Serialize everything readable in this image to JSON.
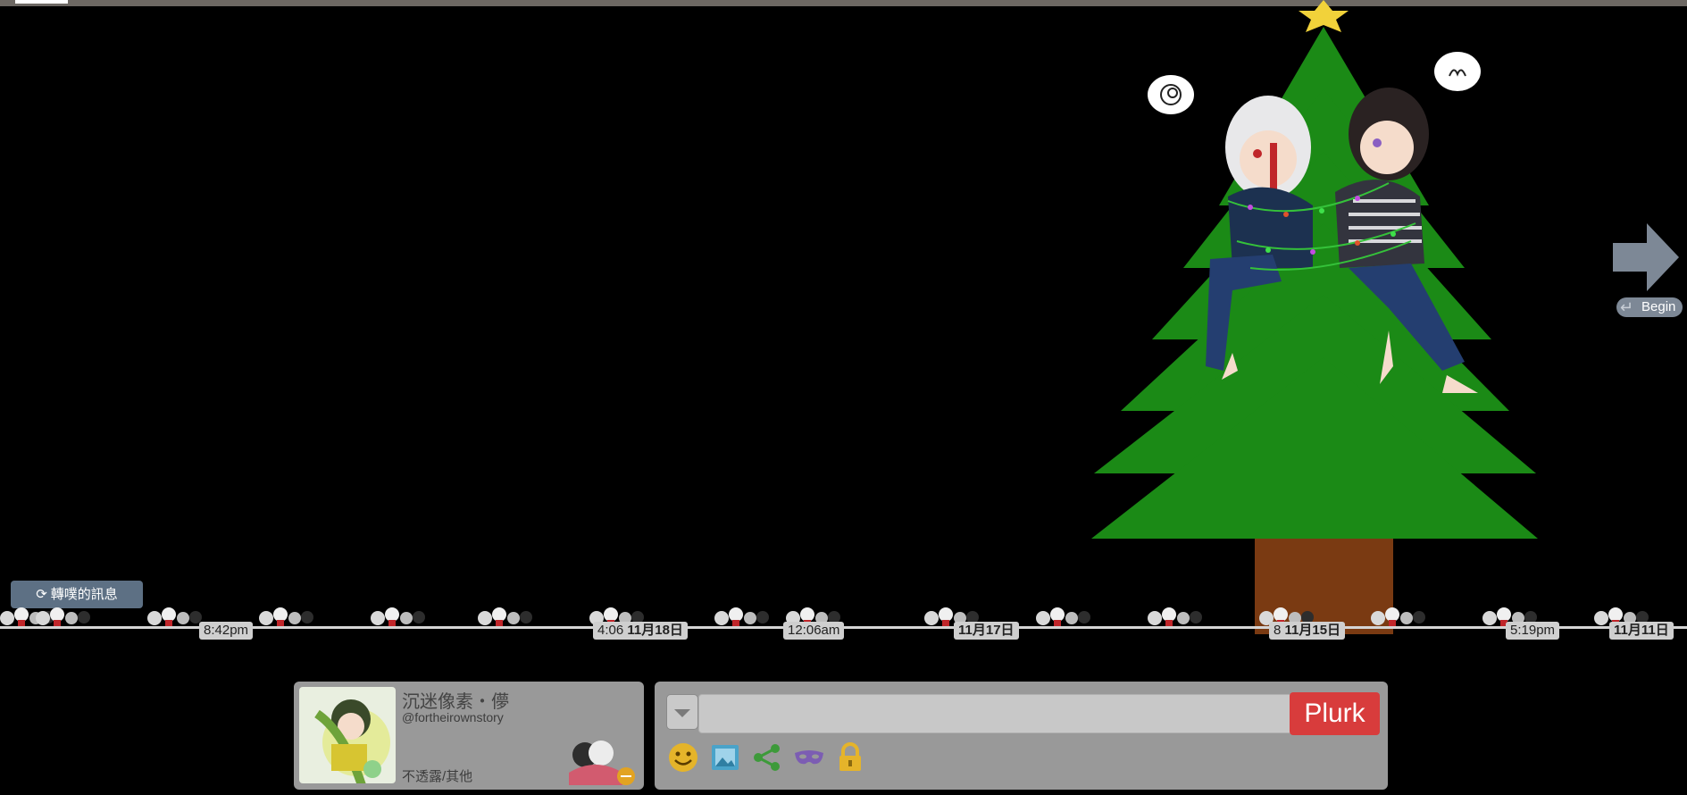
{
  "timeline": {
    "replurk_button": "轉噗的訊息",
    "labels": [
      {
        "text": "8:42pm"
      },
      {
        "text": "4:06",
        "bold": "11月18日"
      },
      {
        "text": "12:06am"
      },
      {
        "text": "",
        "bold": "11月17日"
      },
      {
        "text": "8",
        "bold": "11月15日"
      },
      {
        "text": "5:19pm"
      },
      {
        "text": "",
        "bold": "11月11日"
      }
    ]
  },
  "navigation": {
    "begin_label": "Begin",
    "next_icon": "right-arrow-icon"
  },
  "profile": {
    "display_name": "沉迷像素・儚",
    "handle": "@fortheirownstory",
    "status": "不透露/其他"
  },
  "compose": {
    "input_value": "",
    "input_placeholder": "",
    "submit_label": "Plurk",
    "tools": [
      "emoticon-icon",
      "image-upload-icon",
      "share-icon",
      "anonymous-mask-icon",
      "lock-icon"
    ]
  },
  "colors": {
    "background": "#000000",
    "tree_green": "#1b8a16",
    "trunk": "#7a3a12",
    "plurk_red": "#d83c3c",
    "panel_gray": "#999999",
    "replurk_blue": "#5d7084"
  }
}
